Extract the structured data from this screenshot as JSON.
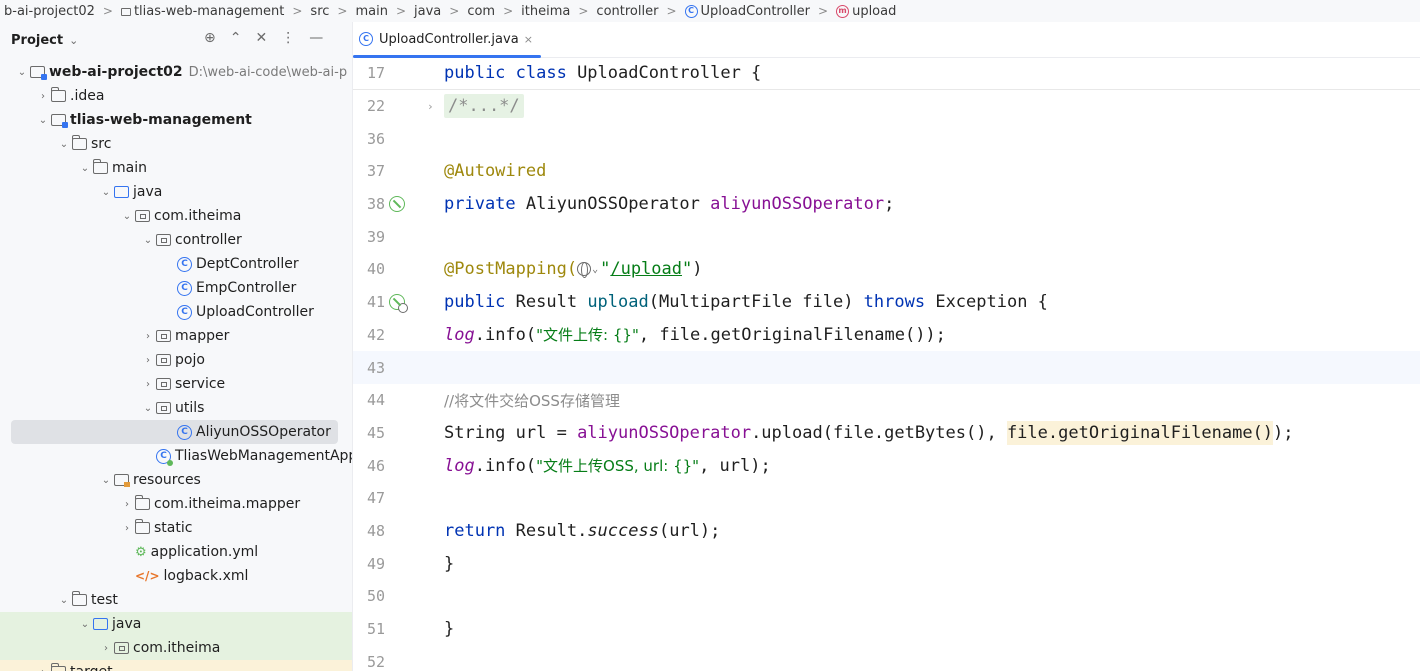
{
  "breadcrumb": [
    {
      "label": "b-ai-project02",
      "icon": ""
    },
    {
      "label": "tlias-web-management",
      "icon": "module-icon"
    },
    {
      "label": "src",
      "icon": ""
    },
    {
      "label": "main",
      "icon": ""
    },
    {
      "label": "java",
      "icon": ""
    },
    {
      "label": "com",
      "icon": ""
    },
    {
      "label": "itheima",
      "icon": ""
    },
    {
      "label": "controller",
      "icon": ""
    },
    {
      "label": "UploadController",
      "icon": "class-icon"
    },
    {
      "label": "upload",
      "icon": "method-icon"
    }
  ],
  "project_panel": {
    "title": "Project",
    "tree": [
      {
        "label": "web-ai-project02",
        "extra": "D:\\web-ai-code\\web-ai-p",
        "bold": true,
        "icon": "module",
        "arrow": "v"
      },
      {
        "label": ".idea",
        "icon": "folder",
        "arrow": ">"
      },
      {
        "label": "tlias-web-management",
        "bold": true,
        "icon": "module",
        "arrow": "v"
      },
      {
        "label": "src",
        "icon": "folder",
        "arrow": "v"
      },
      {
        "label": "main",
        "icon": "folder",
        "arrow": "v"
      },
      {
        "label": "java",
        "icon": "src",
        "arrow": "v"
      },
      {
        "label": "com.itheima",
        "icon": "package",
        "arrow": "v"
      },
      {
        "label": "controller",
        "icon": "package",
        "arrow": "v"
      },
      {
        "label": "DeptController",
        "icon": "class",
        "arrow": ""
      },
      {
        "label": "EmpController",
        "icon": "class",
        "arrow": ""
      },
      {
        "label": "UploadController",
        "icon": "class",
        "arrow": ""
      },
      {
        "label": "mapper",
        "icon": "package",
        "arrow": ">"
      },
      {
        "label": "pojo",
        "icon": "package",
        "arrow": ">"
      },
      {
        "label": "service",
        "icon": "package",
        "arrow": ">"
      },
      {
        "label": "utils",
        "icon": "package",
        "arrow": "v"
      },
      {
        "label": "AliyunOSSOperator",
        "icon": "class",
        "arrow": "",
        "selected": true
      },
      {
        "label": "TliasWebManagementApp",
        "icon": "app",
        "arrow": ""
      },
      {
        "label": "resources",
        "icon": "res",
        "arrow": "v"
      },
      {
        "label": "com.itheima.mapper",
        "icon": "folder",
        "arrow": ">"
      },
      {
        "label": "static",
        "icon": "folder",
        "arrow": ">"
      },
      {
        "label": "application.yml",
        "icon": "yml",
        "arrow": ""
      },
      {
        "label": "logback.xml",
        "icon": "xml",
        "arrow": ""
      },
      {
        "label": "test",
        "icon": "folder",
        "arrow": "v"
      },
      {
        "label": "java",
        "icon": "src",
        "arrow": "v",
        "highlight": "green"
      },
      {
        "label": "com.itheima",
        "icon": "package",
        "arrow": ">",
        "highlight": "green"
      },
      {
        "label": "target",
        "icon": "folder",
        "arrow": ">",
        "highlight": "yellow"
      }
    ]
  },
  "editor": {
    "tab_label": "UploadController.java",
    "tab_close": "×",
    "lines": {
      "l17": {
        "num": "17",
        "t1": "public class",
        "t2": " UploadController {"
      },
      "l22": {
        "num": "22",
        "t1": "/*...*/"
      },
      "l36": {
        "num": "36"
      },
      "l37": {
        "num": "37",
        "t1": "@Autowired"
      },
      "l38": {
        "num": "38",
        "t1": "private",
        "t2": " AliyunOSSOperator ",
        "t3": "aliyunOSSOperator",
        "t4": ";"
      },
      "l39": {
        "num": "39"
      },
      "l40": {
        "num": "40",
        "t1": "@PostMapping(",
        "t2": "\"",
        "t3": "/upload",
        "t4": "\"",
        "t5": ")"
      },
      "l41": {
        "num": "41",
        "t1": "public",
        "t2": " Result ",
        "t3": "upload",
        "t4": "(MultipartFile file) ",
        "t5": "throws",
        "t6": " Exception {"
      },
      "l42": {
        "num": "42",
        "t1": "log",
        "t2": ".info(",
        "t3": "\"文件上传: {}\"",
        "t4": ", file.getOriginalFilename());"
      },
      "l43": {
        "num": "43"
      },
      "l44": {
        "num": "44",
        "t1": "//将文件交给OSS存储管理"
      },
      "l45": {
        "num": "45",
        "t1": "String url = ",
        "t2": "aliyunOSSOperator",
        "t3": ".upload(file.getBytes(), ",
        "t4": "file.getOriginalFilename()",
        "t5": ");"
      },
      "l46": {
        "num": "46",
        "t1": "log",
        "t2": ".info(",
        "t3": "\"文件上传OSS, url: {}\"",
        "t4": ", url);"
      },
      "l47": {
        "num": "47"
      },
      "l48": {
        "num": "48",
        "t1": "return",
        "t2": " Result.",
        "t3": "success",
        "t4": "(url);"
      },
      "l49": {
        "num": "49",
        "t1": "}"
      },
      "l50": {
        "num": "50"
      },
      "l51": {
        "num": "51",
        "t1": "}"
      },
      "l52": {
        "num": "52"
      }
    }
  }
}
